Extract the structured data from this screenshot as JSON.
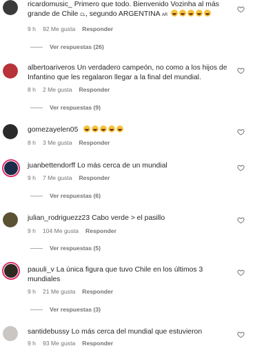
{
  "comments": [
    {
      "user": "ricardomusic_",
      "text": "Primero que todo. Bienvenido Vozinha al más grande de Chile",
      "flag1": "CL",
      "text2": ", segundo ARGENTINA",
      "flag2": "AR",
      "time": "9 h",
      "likes": "92 Me gusta",
      "reply": "Responder",
      "replies": "Ver respuestas (26)",
      "avatar_color": "#3a3a3a"
    },
    {
      "user": "albertoariveros",
      "text": "Un verdadero campeón, no como a los hijos de Infantino que les regalaron llegar a la final del mundial.",
      "time": "8 h",
      "likes": "2 Me gusta",
      "reply": "Responder",
      "replies": "Ver respuestas (9)",
      "avatar_color": "#b8323a"
    },
    {
      "user": "gomezayelen05",
      "time": "8 h",
      "likes": "3 Me gusta",
      "reply": "Responder",
      "avatar_color": "#2a2a2a"
    },
    {
      "user": "juanbettendorff",
      "text": "Lo más cerca de un mundial",
      "time": "9 h",
      "likes": "7 Me gusta",
      "reply": "Responder",
      "replies": "Ver respuestas (6)",
      "avatar_color": "#1c2b4a"
    },
    {
      "user": "julian_rodriguezz23",
      "text": "Cabo verde > el pasillo",
      "time": "9 h",
      "likes": "104 Me gusta",
      "reply": "Responder",
      "replies": "Ver respuestas (5)",
      "avatar_color": "#5a5233"
    },
    {
      "user": "pauuli_v",
      "text": "La única figura que tuvo Chile en los últimos 3 mundiales",
      "time": "9 h",
      "likes": "21 Me gusta",
      "reply": "Responder",
      "replies": "Ver respuestas (3)",
      "avatar_color": "#2e2a22"
    },
    {
      "user": "santidebussy",
      "text": "Lo más cerca del mundial que estuvieron",
      "time": "9 h",
      "likes": "93 Me gusta",
      "reply": "Responder",
      "avatar_color": "#c9c6c4"
    }
  ],
  "colors": {
    "story_ring": "#e1306c",
    "secondary_text": "#737373"
  },
  "icons": {
    "like": "heart-outline-icon"
  }
}
